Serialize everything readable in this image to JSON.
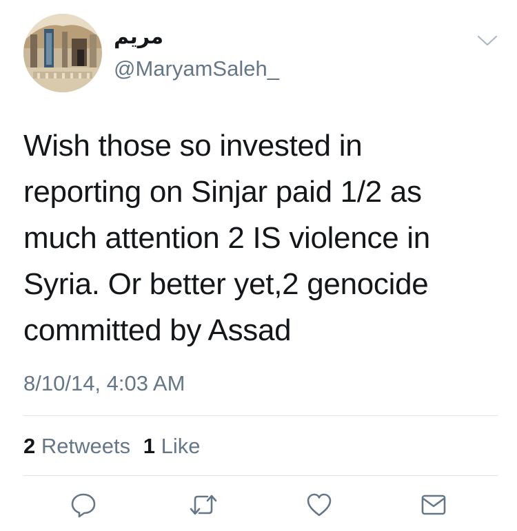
{
  "user": {
    "display_name": "مريم",
    "handle": "@MaryamSaleh_"
  },
  "tweet": {
    "lines": [
      "Wish those so invested in",
      "reporting on Sinjar paid 1/2 as",
      "much attention 2 IS violence in",
      "Syria. Or better yet,2 genocide",
      "committed by Assad"
    ],
    "timestamp": "8/10/14, 4:03 AM"
  },
  "stats": {
    "retweets_count": "2",
    "retweets_label": "Retweets",
    "likes_count": "1",
    "likes_label": "Like"
  },
  "icons": {
    "menu": "chevron-down-icon",
    "reply": "reply-icon",
    "retweet": "retweet-icon",
    "like": "heart-icon",
    "message": "envelope-icon"
  },
  "colors": {
    "text": "#14171a",
    "secondary": "#657786",
    "divider": "#dfe3e6"
  }
}
